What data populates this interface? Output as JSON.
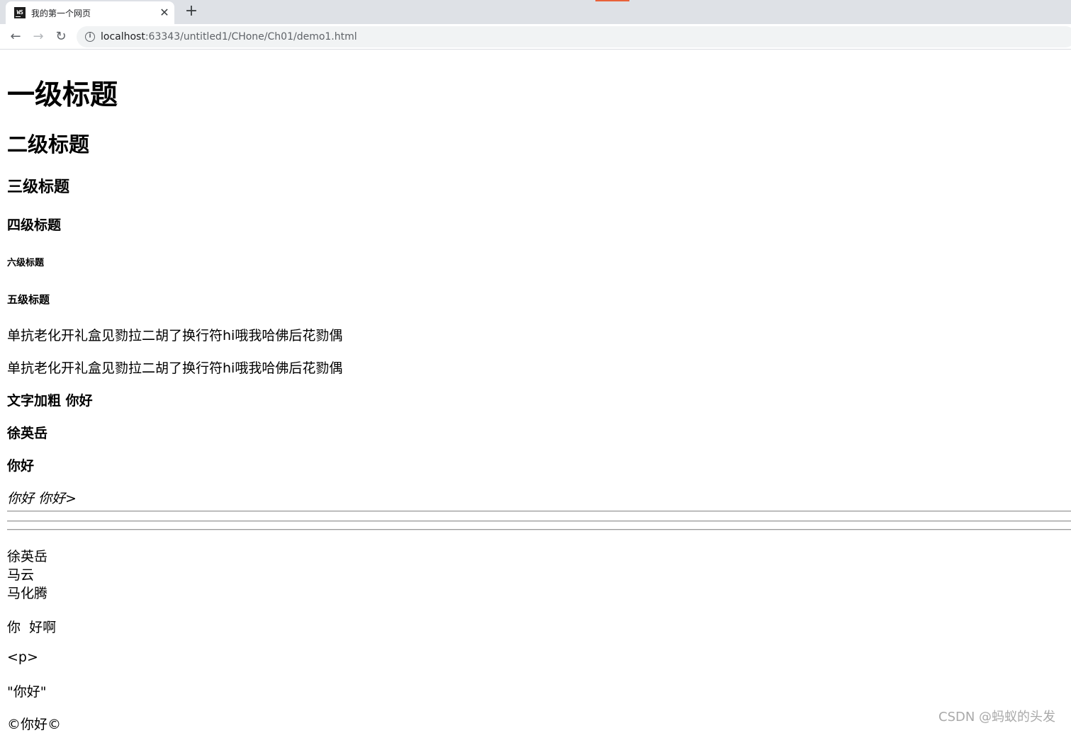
{
  "browser": {
    "tab_title": "我的第一个网页",
    "tab_favicon": "WS",
    "tab_close": "✕",
    "new_tab": "+",
    "url_host": "localhost",
    "url_path": ":63343/untitled1/CHone/Ch01/demo1.html",
    "icons": {
      "back": "←",
      "forward": "→",
      "reload": "↻",
      "info": "i"
    }
  },
  "page": {
    "h1": "一级标题",
    "h2": "二级标题",
    "h3": "三级标题",
    "h4": "四级标题",
    "h6": "六级标题",
    "h5": "五级标题",
    "para1": "单抗老化开礼盒见勠拉二胡了换行符hi哦我哈佛后花勠偶",
    "para2": "单抗老化开礼盒见勠拉二胡了换行符hi哦我哈佛后花勠偶",
    "bold1": "文字加粗 你好",
    "bold2": "徐英岳",
    "bold3": "你好",
    "italic": "你好 你好>",
    "names": [
      "徐英岳",
      "马云",
      "马化腾"
    ],
    "spaced": "你  好啊",
    "tag_text": "<p>",
    "quoted": "\"你好\"",
    "copyright": "©你好©"
  },
  "watermark": "CSDN @蚂蚁的头发"
}
